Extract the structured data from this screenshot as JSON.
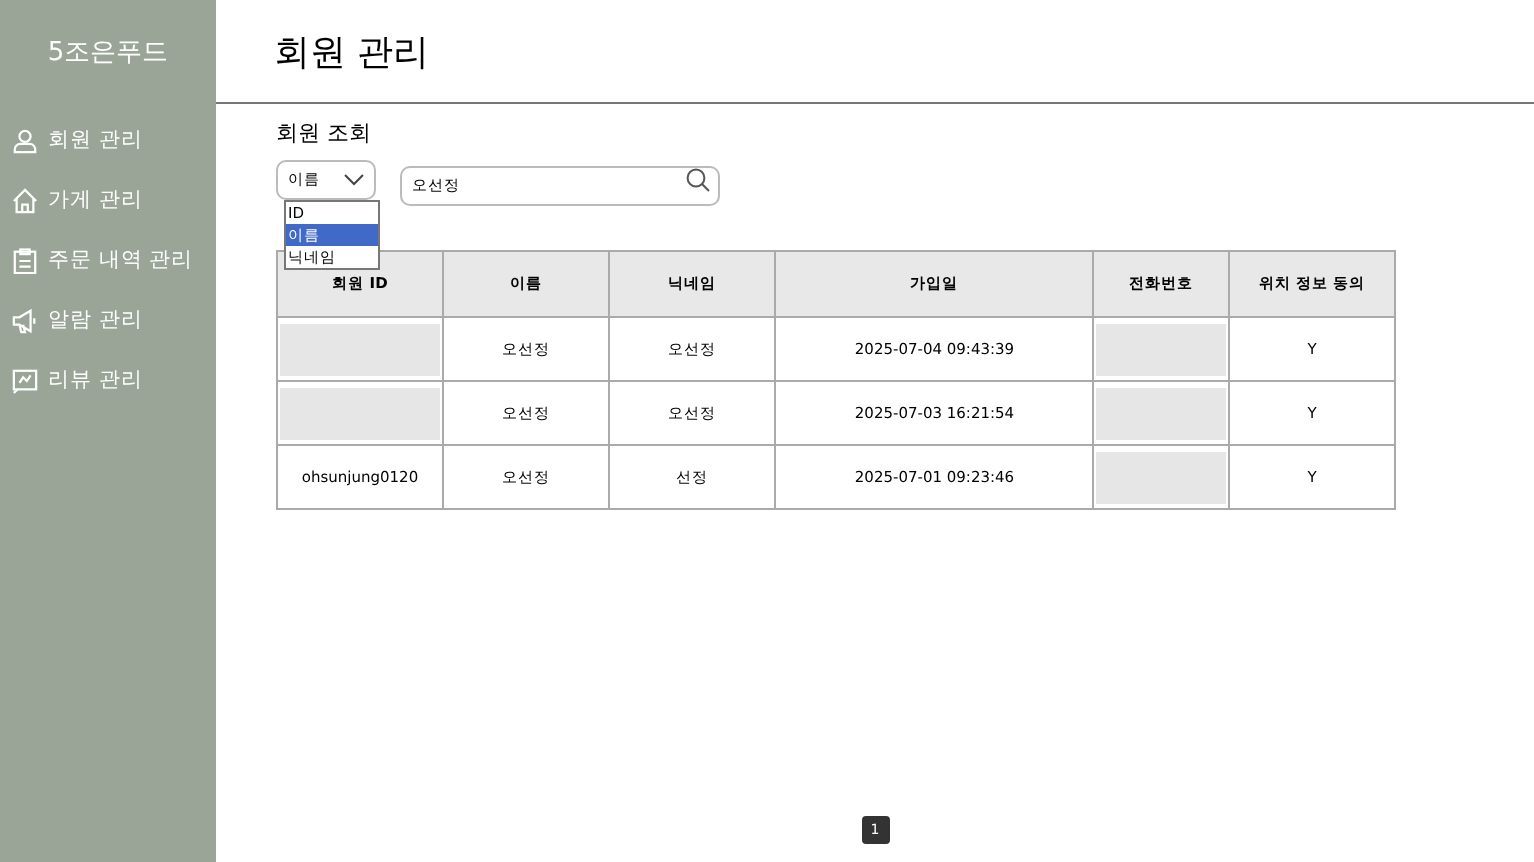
{
  "sidebar": {
    "brand": "5조은푸드",
    "items": [
      {
        "label": "회원 관리",
        "kind": "person"
      },
      {
        "label": "가게 관리",
        "kind": "house"
      },
      {
        "label": "주문 내역 관리",
        "kind": "clipboard"
      },
      {
        "label": "알람 관리",
        "kind": "megaphone"
      },
      {
        "label": "리뷰 관리",
        "kind": "review"
      }
    ]
  },
  "page_title": "회원 관리",
  "section_title": "회원 조회",
  "search": {
    "filter": "이름",
    "options": [
      {
        "label": "ID",
        "selected": false
      },
      {
        "label": "이름",
        "selected": true
      },
      {
        "label": "닉네임",
        "selected": false
      }
    ],
    "value": "오선정"
  },
  "table": {
    "columns": [
      "회원 ID",
      "이름",
      "닉네임",
      "가입일",
      "전화번호",
      "위치 정보 동의"
    ],
    "rows": [
      {
        "member_id": null,
        "name": "오선정",
        "nickname": "오선정",
        "joined": "2025-07-04 09:43:39",
        "phone": null,
        "location_consent": "Y"
      },
      {
        "member_id": null,
        "name": "오선정",
        "nickname": "오선정",
        "joined": "2025-07-03 16:21:54",
        "phone": null,
        "location_consent": "Y"
      },
      {
        "member_id": "ohsunjung0120",
        "name": "오선정",
        "nickname": "선정",
        "joined": "2025-07-01 09:23:46",
        "phone": null,
        "location_consent": "Y"
      }
    ]
  },
  "pagination": [
    {
      "label": "1",
      "selected": true
    }
  ]
}
